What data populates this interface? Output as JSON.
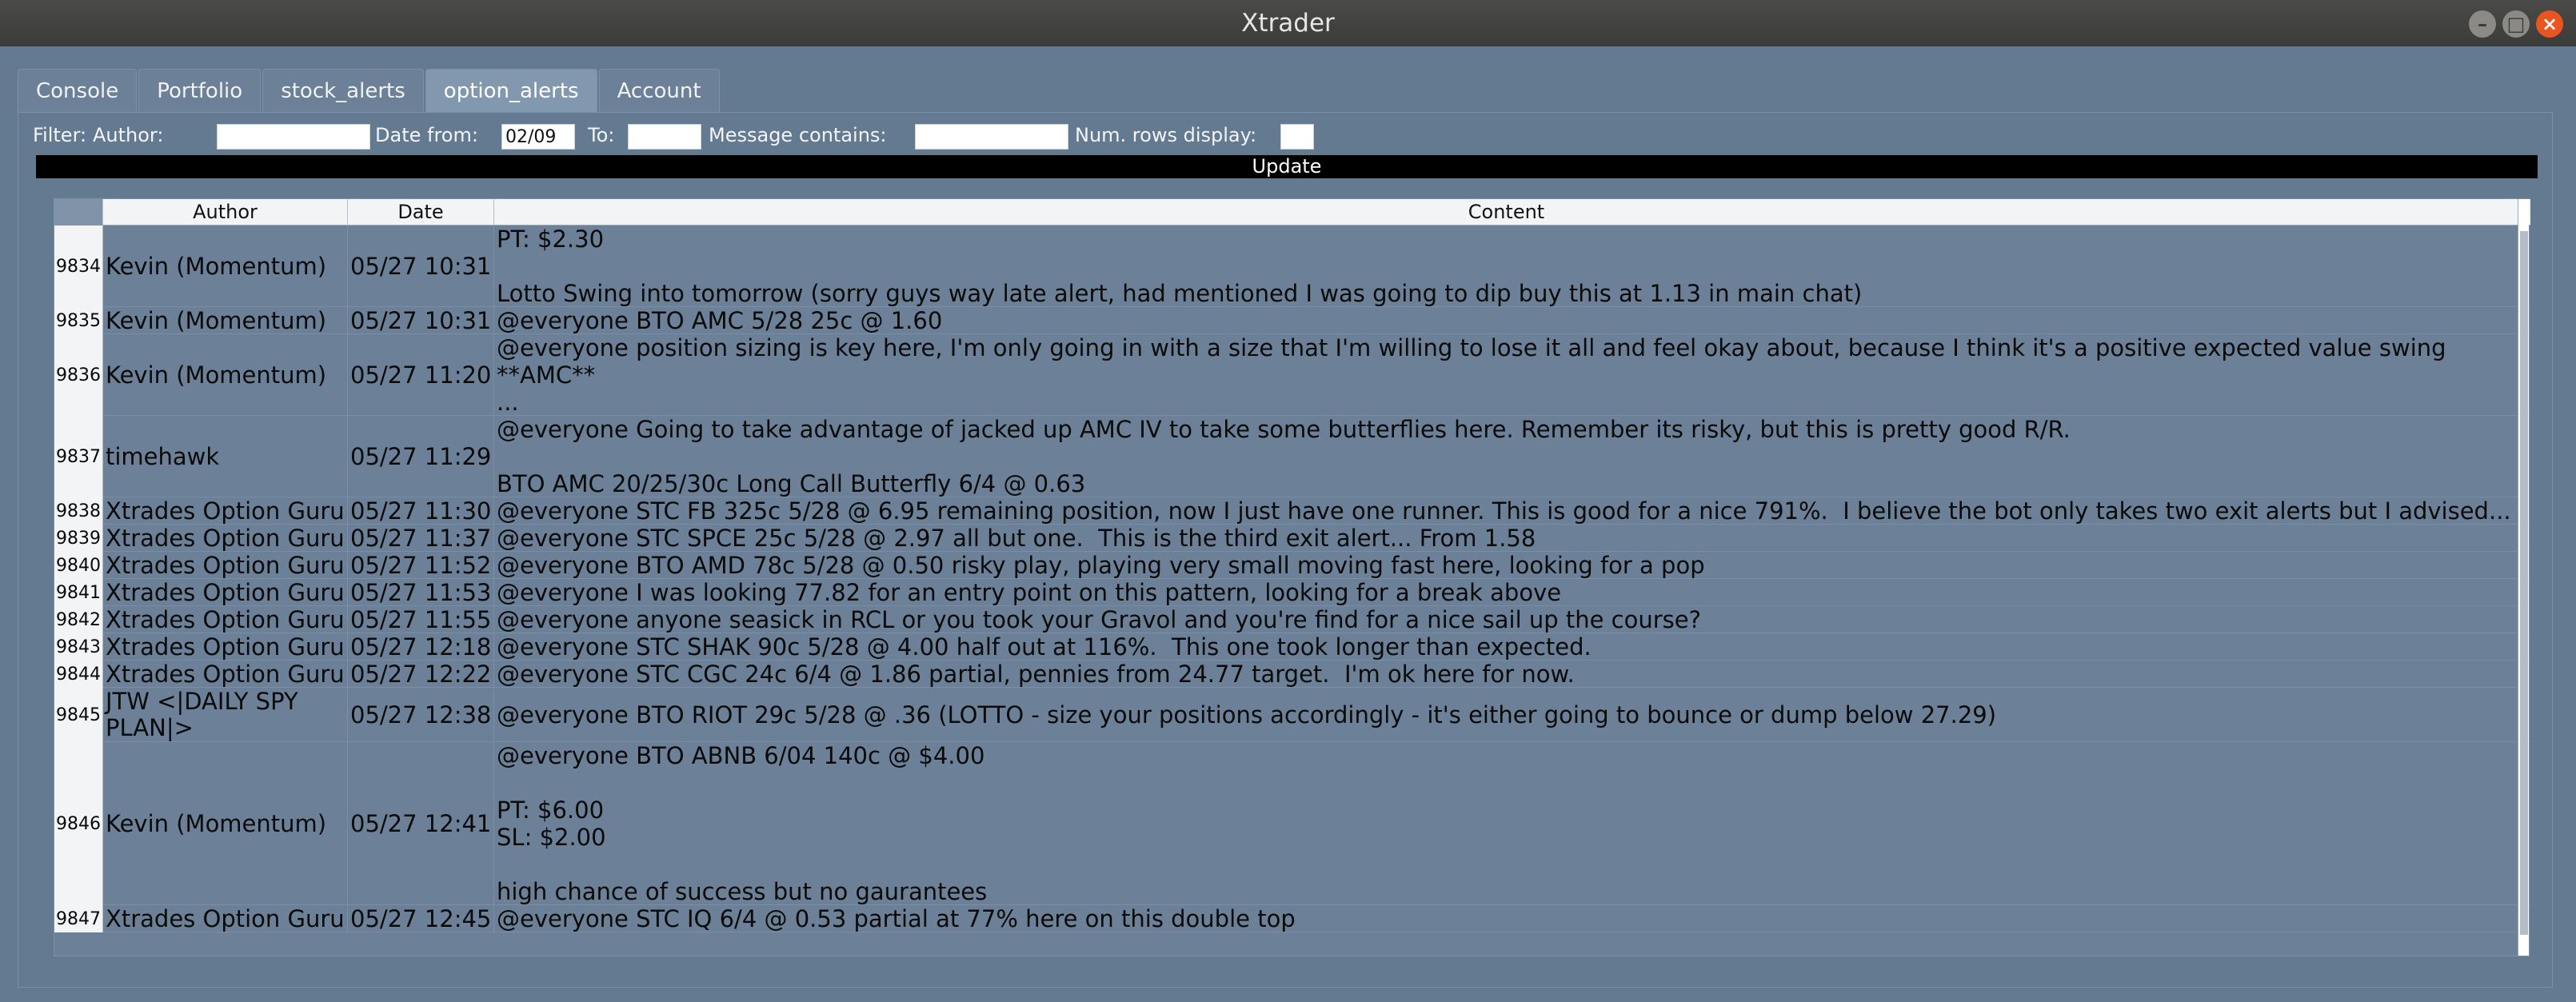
{
  "window": {
    "title": "Xtrader",
    "buttons": {
      "minimize": "–",
      "maximize": "□",
      "close": "×"
    }
  },
  "tabs": [
    {
      "label": "Console",
      "active": false
    },
    {
      "label": "Portfolio",
      "active": false
    },
    {
      "label": "stock_alerts",
      "active": false
    },
    {
      "label": "option_alerts",
      "active": true
    },
    {
      "label": "Account",
      "active": false
    }
  ],
  "filter": {
    "label": "Filter:",
    "author_label": "Author:",
    "author_value": "",
    "date_from_label": "Date from:",
    "date_from_value": "02/09",
    "to_label": "To:",
    "to_value": "",
    "message_label": "Message contains:",
    "message_value": "",
    "num_rows_label": "Num. rows display:",
    "num_rows_value": ""
  },
  "update_button": "Update",
  "table": {
    "columns": [
      "Author",
      "Date",
      "Content"
    ],
    "rows": [
      {
        "id": "9834",
        "author": "Kevin (Momentum)",
        "date": "05/27 10:31",
        "content": "PT: $2.30\n\nLotto Swing into tomorrow (sorry guys way late alert, had mentioned I was going to dip buy this at 1.13 in main chat)",
        "lines": 3
      },
      {
        "id": "9835",
        "author": "Kevin (Momentum)",
        "date": "05/27 10:31",
        "content": "@everyone BTO AMC 5/28 25c @ 1.60",
        "lines": 1
      },
      {
        "id": "9836",
        "author": "Kevin (Momentum)",
        "date": "05/27 11:20",
        "content": "@everyone position sizing is key here, I'm only going in with a size that I'm willing to lose it all and feel okay about, because I think it's a positive expected value swing\n**AMC**\n...",
        "lines": 3
      },
      {
        "id": "9837",
        "author": "timehawk",
        "date": "05/27 11:29",
        "content": "@everyone Going to take advantage of jacked up AMC IV to take some butterflies here. Remember its risky, but this is pretty good R/R.\n\nBTO AMC 20/25/30c Long Call Butterfly 6/4 @ 0.63",
        "lines": 3
      },
      {
        "id": "9838",
        "author": "Xtrades Option Guru",
        "date": "05/27 11:30",
        "content": "@everyone STC FB 325c 5/28 @ 6.95 remaining position, now I just have one runner. This is good for a nice 791%.  I believe the bot only takes two exit alerts but I advised...",
        "lines": 1
      },
      {
        "id": "9839",
        "author": "Xtrades Option Guru",
        "date": "05/27 11:37",
        "content": "@everyone STC SPCE 25c 5/28 @ 2.97 all but one.  This is the third exit alert... From 1.58",
        "lines": 1
      },
      {
        "id": "9840",
        "author": "Xtrades Option Guru",
        "date": "05/27 11:52",
        "content": "@everyone BTO AMD 78c 5/28 @ 0.50 risky play, playing very small moving fast here, looking for a pop",
        "lines": 1
      },
      {
        "id": "9841",
        "author": "Xtrades Option Guru",
        "date": "05/27 11:53",
        "content": "@everyone I was looking 77.82 for an entry point on this pattern, looking for a break above",
        "lines": 1
      },
      {
        "id": "9842",
        "author": "Xtrades Option Guru",
        "date": "05/27 11:55",
        "content": "@everyone anyone seasick in RCL or you took your Gravol and you're find for a nice sail up the course?",
        "lines": 1
      },
      {
        "id": "9843",
        "author": "Xtrades Option Guru",
        "date": "05/27 12:18",
        "content": "@everyone STC SHAK 90c 5/28 @ 4.00 half out at 116%.  This one took longer than expected.",
        "lines": 1
      },
      {
        "id": "9844",
        "author": "Xtrades Option Guru",
        "date": "05/27 12:22",
        "content": "@everyone STC CGC 24c 6/4 @ 1.86 partial, pennies from 24.77 target.  I'm ok here for now.",
        "lines": 1
      },
      {
        "id": "9845",
        "author": "JTW <|DAILY SPY PLAN|>",
        "date": "05/27 12:38",
        "content": "@everyone BTO RIOT 29c 5/28 @ .36 (LOTTO - size your positions accordingly - it's either going to bounce or dump below 27.29)",
        "lines": 2
      },
      {
        "id": "9846",
        "author": "Kevin (Momentum)",
        "date": "05/27 12:41",
        "content": "@everyone BTO ABNB 6/04 140c @ $4.00\n\nPT: $6.00\nSL: $2.00\n\nhigh chance of success but no gaurantees",
        "lines": 6
      },
      {
        "id": "9847",
        "author": "Xtrades Option Guru",
        "date": "05/27 12:45",
        "content": "@everyone STC IQ 6/4 @ 0.53 partial at 77% here on this double top",
        "lines": 1
      }
    ]
  }
}
